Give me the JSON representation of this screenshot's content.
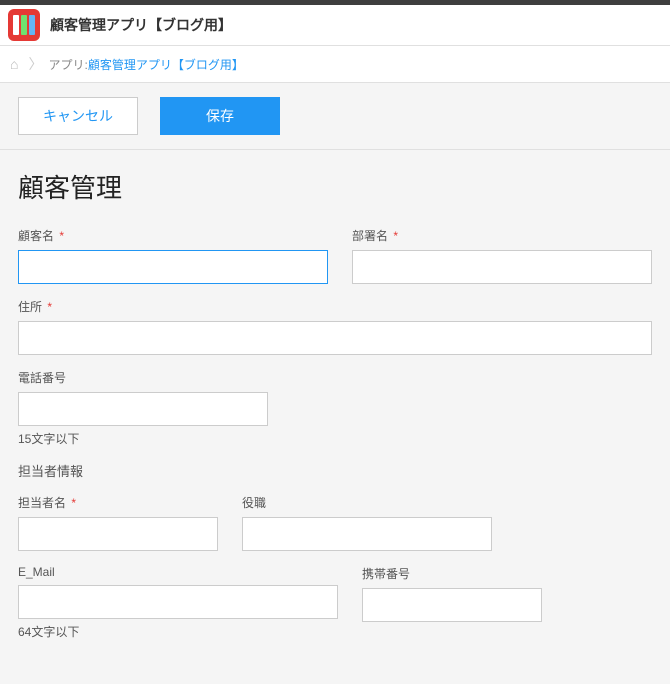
{
  "header": {
    "app_title": "顧客管理アプリ【ブログ用】"
  },
  "breadcrumb": {
    "label": "アプリ:",
    "link_text": "顧客管理アプリ【ブログ用】"
  },
  "buttons": {
    "cancel": "キャンセル",
    "save": "保存"
  },
  "form": {
    "title": "顧客管理",
    "customer_name": {
      "label": "顧客名",
      "required": true,
      "value": ""
    },
    "department": {
      "label": "部署名",
      "required": true,
      "value": ""
    },
    "address": {
      "label": "住所",
      "required": true,
      "value": ""
    },
    "phone": {
      "label": "電話番号",
      "required": false,
      "value": "",
      "hint": "15文字以下"
    },
    "contact_section": "担当者情報",
    "contact_name": {
      "label": "担当者名",
      "required": true,
      "value": ""
    },
    "role": {
      "label": "役職",
      "required": false,
      "value": ""
    },
    "email": {
      "label": "E_Mail",
      "required": false,
      "value": "",
      "hint": "64文字以下"
    },
    "mobile": {
      "label": "携帯番号",
      "required": false,
      "value": ""
    }
  },
  "required_mark": "*"
}
